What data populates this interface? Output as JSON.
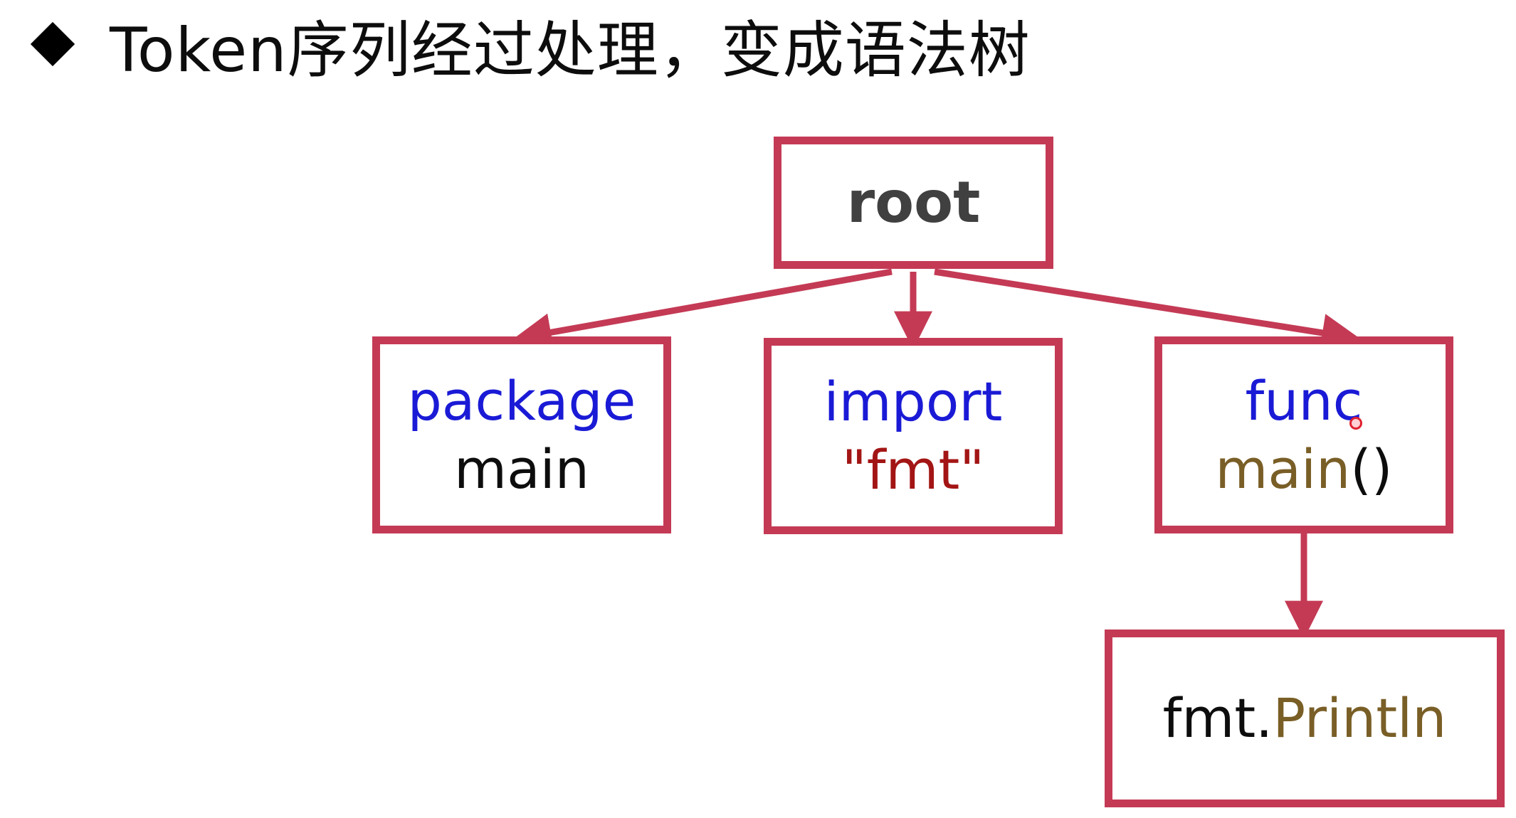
{
  "heading": {
    "text": "Token序列经过处理，变成语法树"
  },
  "colors": {
    "box_border": "#c43a55",
    "arrow": "#c43a55",
    "keyword": "#1a1ad6",
    "plain": "#0d0d0d",
    "string": "#a31515",
    "identifier": "#795e26",
    "root_text": "#404040"
  },
  "tree": {
    "root": {
      "label": "root"
    },
    "package": {
      "keyword": "package",
      "value": "main"
    },
    "import": {
      "keyword": "import",
      "value": "\"fmt\""
    },
    "func": {
      "keyword": "func",
      "name": "main",
      "parens": "()"
    },
    "call": {
      "pkg": "fmt.",
      "name": "Println"
    }
  },
  "edges": [
    {
      "from": "root",
      "to": "package"
    },
    {
      "from": "root",
      "to": "import"
    },
    {
      "from": "root",
      "to": "func"
    },
    {
      "from": "func",
      "to": "call"
    }
  ]
}
